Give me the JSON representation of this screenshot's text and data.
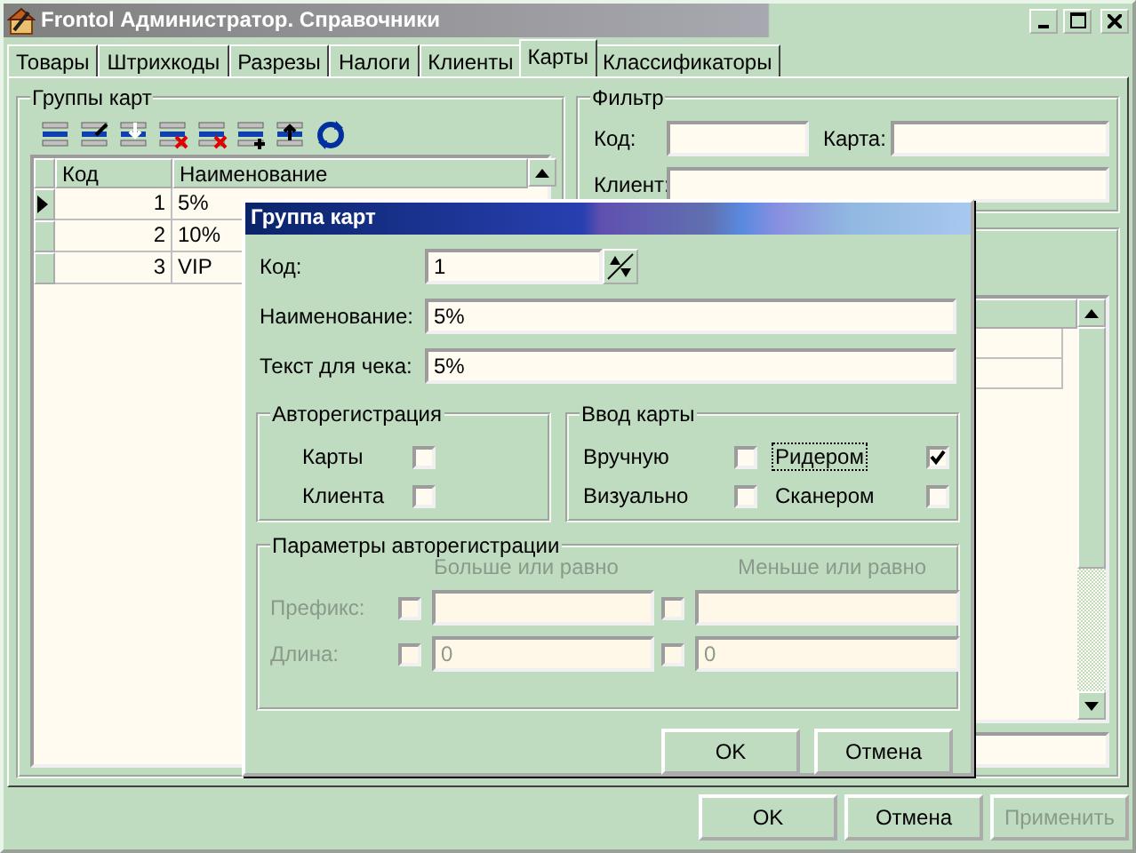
{
  "window": {
    "title": "Frontol Администратор. Справочники"
  },
  "tabs": [
    {
      "label": "Товары",
      "selected": false
    },
    {
      "label": "Штрихкоды",
      "selected": false
    },
    {
      "label": "Разрезы",
      "selected": false
    },
    {
      "label": "Налоги",
      "selected": false
    },
    {
      "label": "Клиенты",
      "selected": false
    },
    {
      "label": "Карты",
      "selected": true
    },
    {
      "label": "Классификаторы",
      "selected": false
    }
  ],
  "card_groups": {
    "title": "Группы карт",
    "table": {
      "columns": [
        "Код",
        "Наименование"
      ],
      "rows": [
        {
          "code": "1",
          "name": "5%",
          "selected": true
        },
        {
          "code": "2",
          "name": "10%",
          "selected": false
        },
        {
          "code": "3",
          "name": "VIP",
          "selected": false
        }
      ]
    }
  },
  "filter": {
    "title": "Фильтр",
    "fields": [
      {
        "label": "Код:"
      },
      {
        "label": "Карта:"
      },
      {
        "label": "Клиент:"
      }
    ]
  },
  "dialog": {
    "title": "Группа карт",
    "fields": [
      {
        "label": "Код:",
        "value": "1",
        "kind": "spin"
      },
      {
        "label": "Наименование:",
        "value": "5%",
        "kind": "text"
      },
      {
        "label": "Текст для чека:",
        "value": "5%",
        "kind": "text"
      }
    ],
    "autoregistration": {
      "title": "Авторегистрация",
      "options": [
        {
          "label": "Карты",
          "checked": false
        },
        {
          "label": "Клиента",
          "checked": false
        }
      ]
    },
    "card_input": {
      "title": "Ввод карты",
      "options": [
        {
          "label": "Вручную",
          "checked": false,
          "focused": false
        },
        {
          "label": "Ридером",
          "checked": true,
          "focused": true
        },
        {
          "label": "Визуально",
          "checked": false,
          "focused": false
        },
        {
          "label": "Сканером",
          "checked": false,
          "focused": false
        }
      ]
    },
    "autoreg_params": {
      "title": "Параметры авторегистрации",
      "disabled": true,
      "columns": [
        "Больше или равно",
        "Меньше или равно"
      ],
      "rows": [
        {
          "label": "Префикс:",
          "cells": [
            {
              "checked": false
            },
            {
              "checked": false
            }
          ]
        },
        {
          "label": "Длина:",
          "cells": [
            {
              "checked": false,
              "value": "0"
            },
            {
              "checked": false,
              "value": "0"
            }
          ]
        }
      ]
    },
    "buttons": [
      "OK",
      "Отмена"
    ]
  },
  "buttons": [
    {
      "label": "OK",
      "disabled": false
    },
    {
      "label": "Отмена",
      "disabled": false
    },
    {
      "label": "Применить",
      "disabled": true
    }
  ]
}
